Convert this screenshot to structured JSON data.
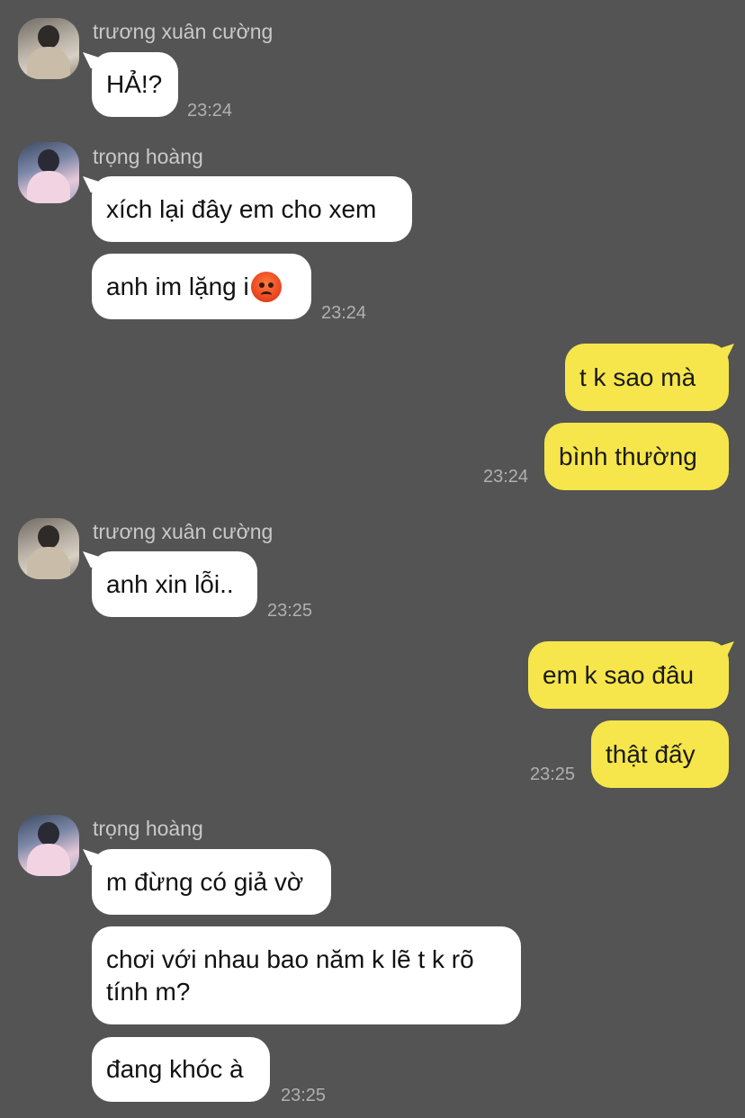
{
  "messages": [
    {
      "sender": "trương xuân cường",
      "avatar": "avatar-photo-cuong",
      "texts": [
        "HẢ!?"
      ],
      "time": "23:24"
    },
    {
      "sender": "trọng hoàng",
      "avatar": "avatar-photo-hoang",
      "texts": [
        "xích lại đây em cho xem",
        "anh im lặng i"
      ],
      "emoji": "angry-face-emoji",
      "time": "23:24"
    },
    {
      "sender": "me",
      "texts": [
        "t k sao mà",
        "bình thường"
      ],
      "time": "23:24"
    },
    {
      "sender": "trương xuân cường",
      "avatar": "avatar-photo-cuong",
      "texts": [
        "anh xin lỗi.."
      ],
      "time": "23:25"
    },
    {
      "sender": "me",
      "texts": [
        "em k sao đâu",
        "thật đấy"
      ],
      "time": "23:25"
    },
    {
      "sender": "trọng hoàng",
      "avatar": "avatar-photo-hoang",
      "texts": [
        "m đừng có giả vờ",
        "chơi với nhau bao năm k lẽ t k rõ tính m?",
        "đang khóc à"
      ],
      "time": "23:25"
    }
  ],
  "colors": {
    "background": "#545454",
    "incoming_bubble": "#ffffff",
    "outgoing_bubble": "#f6e64b",
    "name_text": "#c9c9c9",
    "time_text": "#b0b0b0"
  }
}
